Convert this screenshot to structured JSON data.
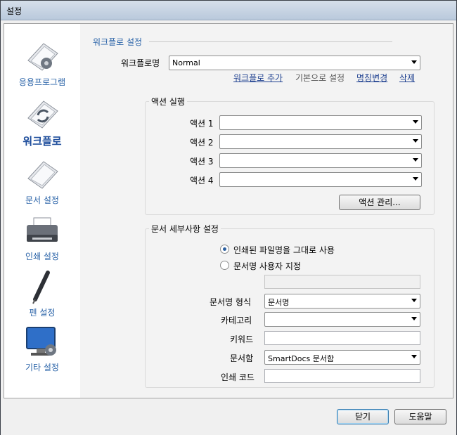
{
  "window": {
    "title": "설정"
  },
  "sidebar": {
    "items": [
      {
        "label": "응용프로그램",
        "icon": "application-icon"
      },
      {
        "label": "워크플로",
        "icon": "workflow-icon",
        "active": true
      },
      {
        "label": "문서 설정",
        "icon": "document-icon"
      },
      {
        "label": "인쇄 설정",
        "icon": "printer-icon"
      },
      {
        "label": "펜 설정",
        "icon": "pen-icon"
      },
      {
        "label": "기타 설정",
        "icon": "monitor-settings-icon"
      }
    ]
  },
  "workflow": {
    "section_title": "워크플로 설정",
    "name_label": "워크플로명",
    "name_value": "Normal",
    "links": {
      "add": "워크플로 추가",
      "set_default": "기본으로 설정",
      "rename": "명칭변경",
      "delete": "삭제"
    }
  },
  "actions": {
    "group_title": "액션 실행",
    "rows": [
      {
        "label": "액션 1",
        "value": ""
      },
      {
        "label": "액션 2",
        "value": ""
      },
      {
        "label": "액션 3",
        "value": ""
      },
      {
        "label": "액션 4",
        "value": ""
      }
    ],
    "manage_button": "액션 관리..."
  },
  "doc_details": {
    "group_title": "문서 세부사항 설정",
    "radio_use_printed": "인쇄된 파일명을 그대로 사용",
    "radio_custom_name": "문서명 사용자 지정",
    "custom_name_value": "",
    "format_label": "문서명 형식",
    "format_value": "문서명",
    "category_label": "카테고리",
    "category_value": "",
    "keyword_label": "키워드",
    "keyword_value": "",
    "docbox_label": "문서함",
    "docbox_value": "SmartDocs 문서함",
    "print_code_label": "인쇄 코드",
    "print_code_value": ""
  },
  "footer": {
    "close_button": "닫기",
    "help_button": "도움말"
  },
  "colors": {
    "accent": "#2a63a8",
    "link": "#1d3f8f",
    "content_bg": "#f3f3f3"
  }
}
